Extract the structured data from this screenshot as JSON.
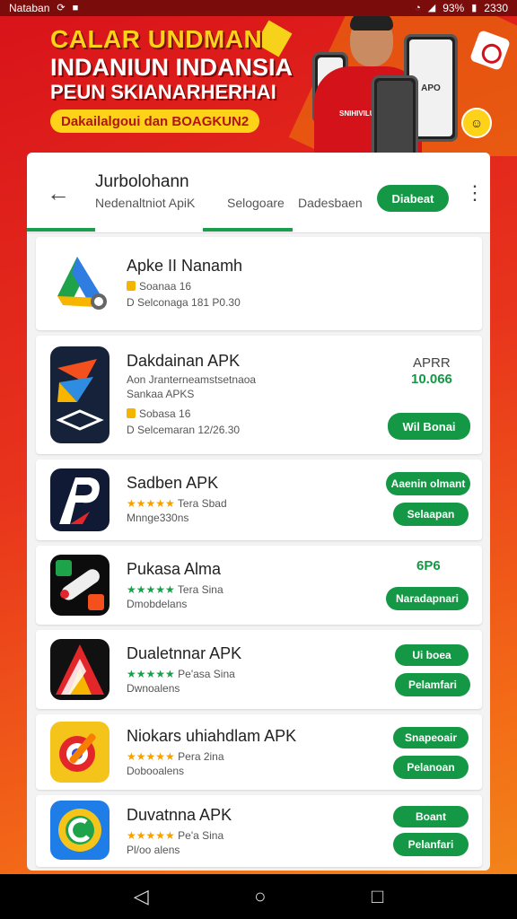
{
  "status": {
    "left": "Nataban",
    "time": "2330",
    "battery": "93%"
  },
  "banner": {
    "line1": "CALAR UNDMAN",
    "line2": "INDANIUN INDANSIA",
    "line3": "PEUN SKIANARHERHAI",
    "pill": "Dakailalgoui dan BOAGKUN2",
    "shirt_text": "SNIHIVILU",
    "phone_text": "APO"
  },
  "topbar": {
    "title": "Jurbolohann",
    "tabs": [
      "Nedenaltniot ApiK",
      "Selogoare",
      "Dadesbaen"
    ],
    "button": "Diabeat"
  },
  "apps": [
    {
      "name": "Apke II Nanamh",
      "meta1": "Soanaa 16",
      "meta2": "D Selconaga 181 P0.30"
    },
    {
      "name": "Dakdainan APK",
      "desc1": "Aon Jranterneamstsetnaoa",
      "desc2": "Sankaa APKS",
      "meta1": "Sobasa 16",
      "meta2": "D Selcemaran 12/26.30",
      "price_label": "APRR",
      "price": "10.066",
      "button": "Wil Bonai"
    },
    {
      "name": "Sadben APK",
      "stars": "★★★★★",
      "rating": "Tera Sbad",
      "meta2": "Mnnge330ns",
      "button1": "Aaenin olmant",
      "button2": "Selaapan"
    },
    {
      "name": "Pukasa Alma",
      "stars": "★★★★★",
      "rating": "Tera Sina",
      "meta2": "Dmobdelans",
      "price": "6P6",
      "button": "Naradapnari"
    },
    {
      "name": "Dualetnnar APK",
      "stars": "★★★★★",
      "rating": "Pe'asa Sina",
      "meta2": "Dwnoalens",
      "button1": "Ui boea",
      "button2": "Pelamfari"
    },
    {
      "name": "Niokars uhiahdlam APK",
      "stars": "★★★★★",
      "rating": "Pera 2ina",
      "meta2": "Dobooalens",
      "button1": "Snapeoair",
      "button2": "Pelanoan"
    },
    {
      "name": "Duvatnna APK",
      "stars": "★★★★★",
      "rating": "Pe'a Sina",
      "meta2": "Pl/oo alens",
      "button1": "Boant",
      "button2": "Pelanfari"
    }
  ],
  "nav": {
    "back": "◁",
    "home": "○",
    "recents": "□"
  }
}
